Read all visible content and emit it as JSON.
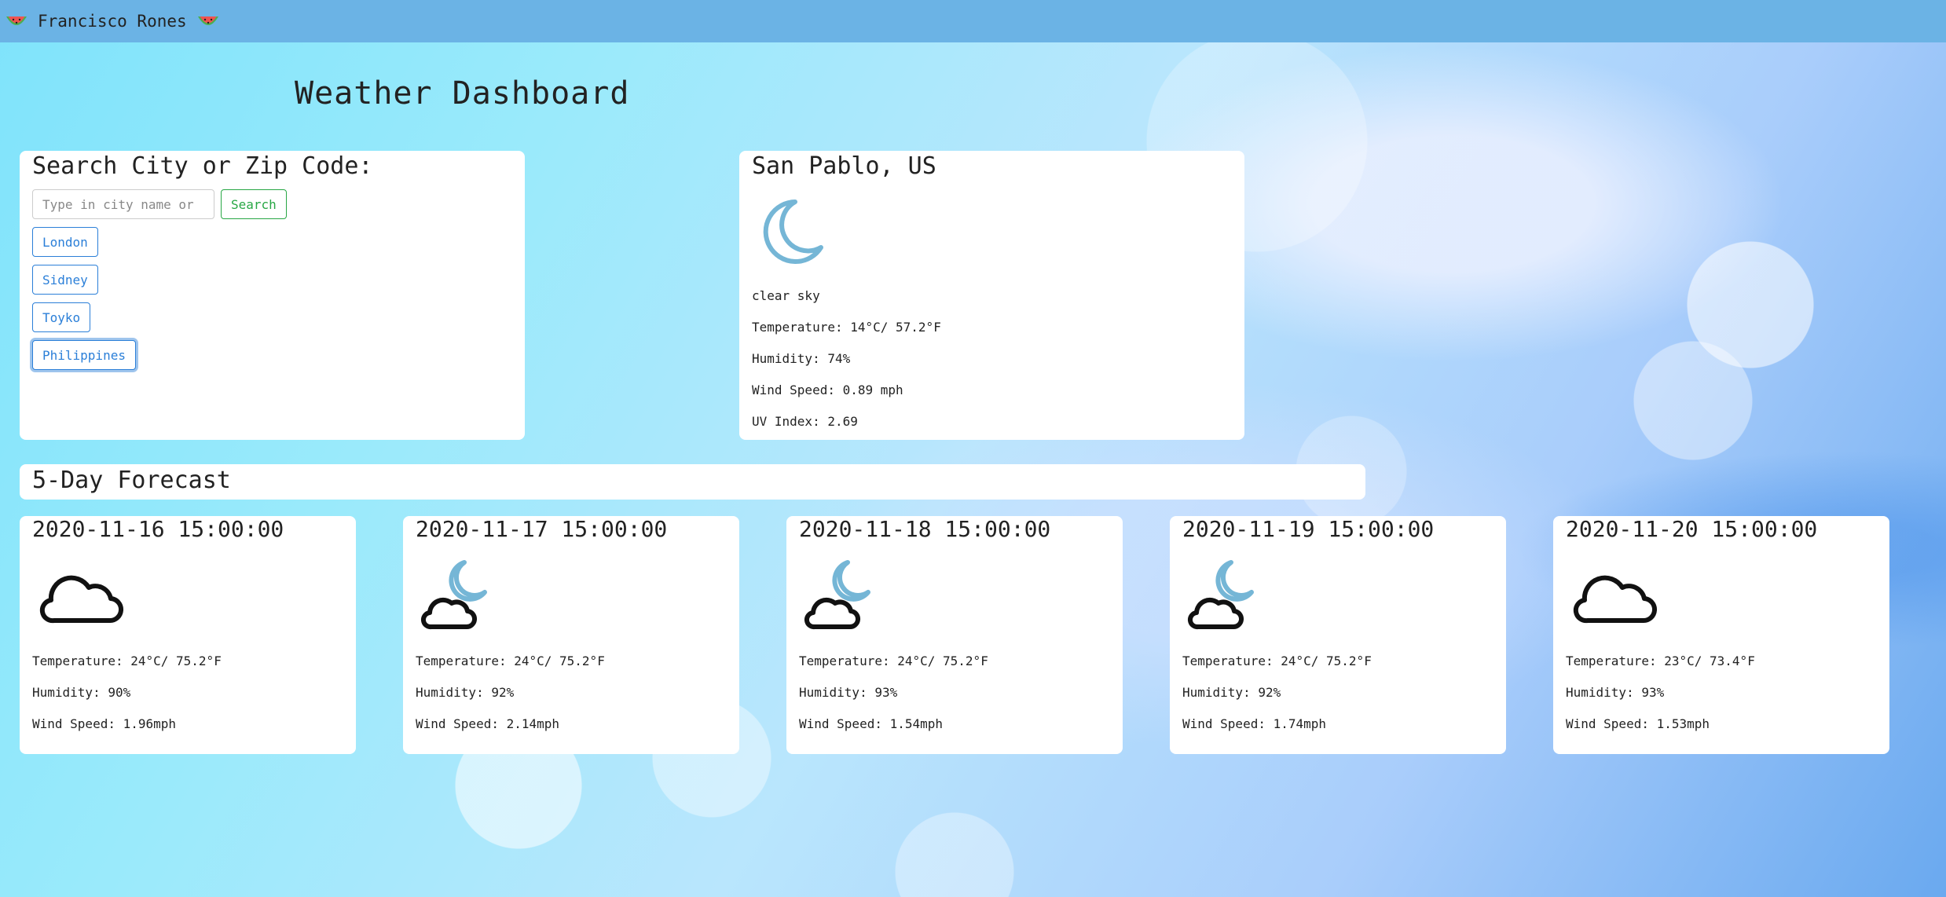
{
  "navbar": {
    "brand": "Francisco Rones",
    "left_icon": "watermelon-icon",
    "right_icon": "watermelon-icon"
  },
  "page_title": "Weather Dashboard",
  "search": {
    "heading": "Search City or Zip Code:",
    "input_value": "",
    "placeholder": "Type in city name or",
    "button_label": "Search",
    "history": [
      "London",
      "Sidney",
      "Toyko",
      "Philippines"
    ]
  },
  "current": {
    "city": "San Pablo, US",
    "icon": "moon-icon",
    "description": "clear sky",
    "temperature": "Temperature: 14°C/ 57.2°F",
    "humidity": "Humidity: 74%",
    "wind": "Wind Speed: 0.89 mph",
    "uv": "UV Index: 2.69"
  },
  "forecast": {
    "heading": "5-Day Forecast",
    "days": [
      {
        "date": "2020-11-16 15:00:00",
        "icon": "cloud-icon",
        "temperature": "Temperature: 24°C/ 75.2°F",
        "humidity": "Humidity: 90%",
        "wind": "Wind Speed: 1.96mph"
      },
      {
        "date": "2020-11-17 15:00:00",
        "icon": "cloud-moon-icon",
        "temperature": "Temperature: 24°C/ 75.2°F",
        "humidity": "Humidity: 92%",
        "wind": "Wind Speed: 2.14mph"
      },
      {
        "date": "2020-11-18 15:00:00",
        "icon": "cloud-moon-icon",
        "temperature": "Temperature: 24°C/ 75.2°F",
        "humidity": "Humidity: 93%",
        "wind": "Wind Speed: 1.54mph"
      },
      {
        "date": "2020-11-19 15:00:00",
        "icon": "cloud-moon-icon",
        "temperature": "Temperature: 24°C/ 75.2°F",
        "humidity": "Humidity: 92%",
        "wind": "Wind Speed: 1.74mph"
      },
      {
        "date": "2020-11-20 15:00:00",
        "icon": "cloud-icon",
        "temperature": "Temperature: 23°C/ 73.4°F",
        "humidity": "Humidity: 93%",
        "wind": "Wind Speed: 1.53mph"
      }
    ]
  },
  "colors": {
    "navbar": "#6bb3e5",
    "search_button": "#28a745",
    "city_button": "#2b7fd8",
    "moon": "#75b6d6"
  }
}
